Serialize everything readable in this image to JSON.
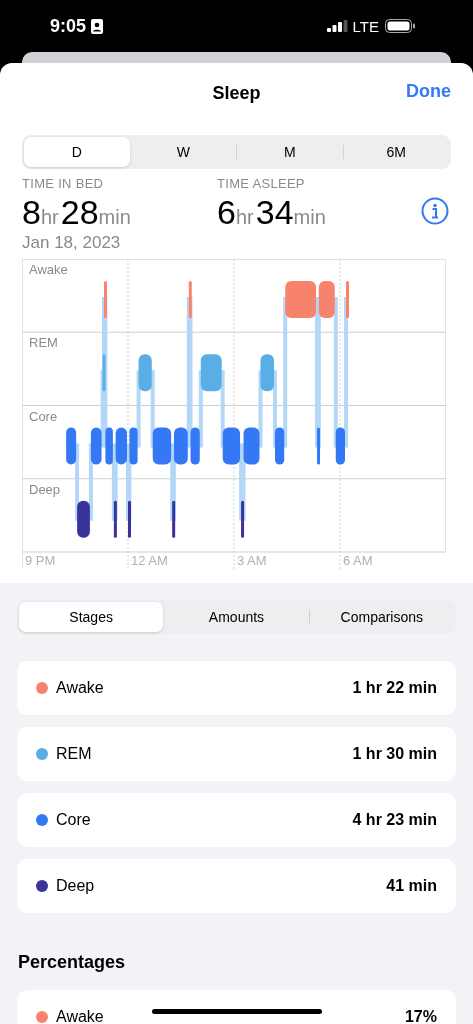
{
  "status_bar": {
    "time": "9:05",
    "network": "LTE"
  },
  "header": {
    "title": "Sleep",
    "action": "Done"
  },
  "range_tabs": [
    {
      "label": "D",
      "selected": true
    },
    {
      "label": "W",
      "selected": false
    },
    {
      "label": "M",
      "selected": false
    },
    {
      "label": "6M",
      "selected": false
    }
  ],
  "summary": [
    {
      "label": "TIME IN BED",
      "hours": "8",
      "hours_unit": "hr",
      "minutes": "28",
      "minutes_unit": "min"
    },
    {
      "label": "TIME ASLEEP",
      "hours": "6",
      "hours_unit": "hr",
      "minutes": "34",
      "minutes_unit": "min"
    }
  ],
  "date": "Jan 18, 2023",
  "chart": {
    "stage_labels": [
      "Awake",
      "REM",
      "Core",
      "Deep"
    ],
    "time_labels": [
      "9 PM",
      "12 AM",
      "3 AM",
      "6 AM"
    ]
  },
  "view_tabs": [
    {
      "label": "Stages",
      "selected": true
    },
    {
      "label": "Amounts",
      "selected": false
    },
    {
      "label": "Comparisons",
      "selected": false
    }
  ],
  "stages": [
    {
      "name": "Awake",
      "color": "#f8836d",
      "amount": "1 hr 22 min"
    },
    {
      "name": "REM",
      "color": "#5aaee6",
      "amount": "1 hr 30 min"
    },
    {
      "name": "Core",
      "color": "#3478f6",
      "amount": "4 hr 23 min"
    },
    {
      "name": "Deep",
      "color": "#38349c",
      "amount": "41 min"
    }
  ],
  "percentages": {
    "title": "Percentages",
    "rows": [
      {
        "name": "Awake",
        "color": "#f8836d",
        "value": "17%"
      }
    ]
  }
}
